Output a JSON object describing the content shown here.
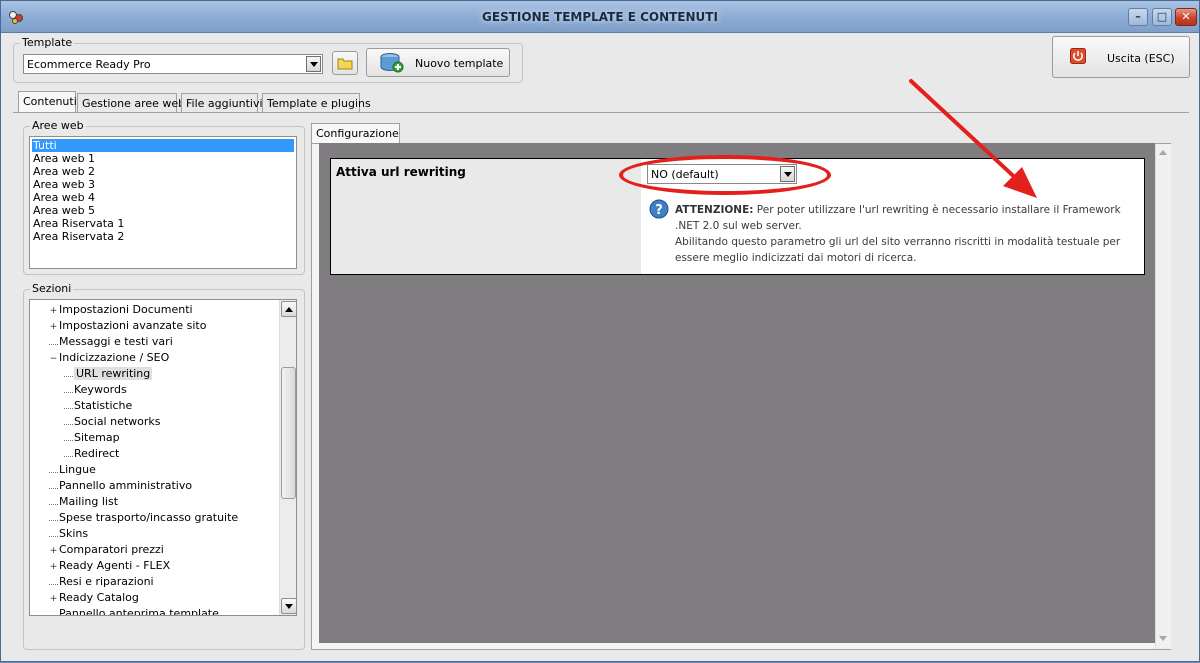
{
  "window": {
    "title": "GESTIONE TEMPLATE E CONTENUTI",
    "controls": {
      "minimize": "–",
      "maximize": "□",
      "close": "✕"
    }
  },
  "template_group": {
    "legend": "Template",
    "selected_template": "Ecommerce Ready Pro",
    "new_template_label": "Nuovo template"
  },
  "exit_button": {
    "label": "Uscita (ESC)"
  },
  "main_tabs": [
    {
      "label": "Contenuti",
      "active": true
    },
    {
      "label": "Gestione aree web",
      "active": false
    },
    {
      "label": "File aggiuntivi",
      "active": false
    },
    {
      "label": "Template e plugins",
      "active": false
    }
  ],
  "aree_web": {
    "legend": "Aree web",
    "items": [
      "Tutti",
      "Area web 1",
      "Area web 2",
      "Area web 3",
      "Area web 4",
      "Area web 5",
      "Area Riservata 1",
      "Area Riservata 2"
    ],
    "selected_index": 0
  },
  "sezioni": {
    "legend": "Sezioni",
    "items": [
      {
        "label": "Impostazioni Documenti",
        "expander": "+",
        "level": 0
      },
      {
        "label": "Impostazioni avanzate sito",
        "expander": "+",
        "level": 0
      },
      {
        "label": "Messaggi e testi vari",
        "expander": "",
        "level": 0
      },
      {
        "label": "Indicizzazione / SEO",
        "expander": "−",
        "level": 0
      },
      {
        "label": "URL rewriting",
        "expander": "",
        "level": 1,
        "selected": true
      },
      {
        "label": "Keywords",
        "expander": "",
        "level": 1
      },
      {
        "label": "Statistiche",
        "expander": "",
        "level": 1
      },
      {
        "label": "Social networks",
        "expander": "",
        "level": 1
      },
      {
        "label": "Sitemap",
        "expander": "",
        "level": 1
      },
      {
        "label": "Redirect",
        "expander": "",
        "level": 1
      },
      {
        "label": "Lingue",
        "expander": "",
        "level": 0
      },
      {
        "label": "Pannello amministrativo",
        "expander": "",
        "level": 0
      },
      {
        "label": "Mailing list",
        "expander": "",
        "level": 0
      },
      {
        "label": "Spese trasporto/incasso gratuite",
        "expander": "",
        "level": 0
      },
      {
        "label": "Skins",
        "expander": "",
        "level": 0
      },
      {
        "label": "Comparatori prezzi",
        "expander": "+",
        "level": 0
      },
      {
        "label": "Ready Agenti - FLEX",
        "expander": "+",
        "level": 0
      },
      {
        "label": "Resi e riparazioni",
        "expander": "",
        "level": 0
      },
      {
        "label": "Ready Catalog",
        "expander": "+",
        "level": 0
      },
      {
        "label": "Pannello anteprima template",
        "expander": "",
        "level": 0
      }
    ]
  },
  "config_tab": {
    "label": "Configurazione"
  },
  "setting": {
    "label": "Attiva url rewriting",
    "value": "NO (default)",
    "warning_title": "ATTENZIONE:",
    "warning_text": " Per poter utilizzare l'url rewriting è necessario installare il Framework .NET 2.0 sul web server.",
    "info_text": "Abilitando questo parametro gli url del sito verranno riscritti in modalità testuale per essere meglio indicizzati dai motori di ricerca."
  },
  "colors": {
    "annotation": "#e3201b",
    "selection": "#3399ff",
    "panel_background": "#7f7d80"
  },
  "icons": {
    "app": "app-icon",
    "folder": "folder-icon",
    "new_template": "database-add-icon",
    "exit": "power-icon",
    "help": "question-icon"
  }
}
